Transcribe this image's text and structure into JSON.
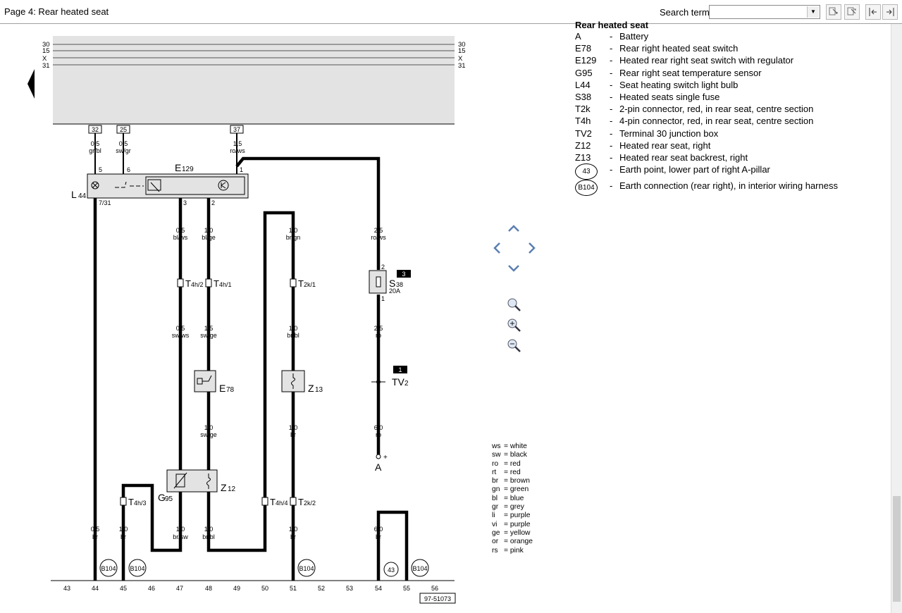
{
  "window": {
    "page_title": "Page 4: Rear heated seat"
  },
  "search": {
    "label": "Search term:",
    "value": "",
    "placeholder": ""
  },
  "toolbar": {
    "buttons": [
      "find-next-icon",
      "find-prev-icon",
      "collapse-icon",
      "expand-icon"
    ]
  },
  "legend": {
    "title": "Rear heated seat",
    "items": [
      {
        "code": "A",
        "desc": "Battery"
      },
      {
        "code": "E78",
        "desc": "Rear right heated seat switch"
      },
      {
        "code": "E129",
        "desc": "Heated rear right seat switch with regulator"
      },
      {
        "code": "G95",
        "desc": "Rear right seat temperature sensor"
      },
      {
        "code": "L44",
        "desc": "Seat heating switch light bulb"
      },
      {
        "code": "S38",
        "desc": "Heated seats single fuse"
      },
      {
        "code": "T2k",
        "desc": "2-pin connector, red, in rear seat, centre section"
      },
      {
        "code": "T4h",
        "desc": "4-pin connector, red, in rear seat, centre section"
      },
      {
        "code": "TV2",
        "desc": "Terminal 30 junction box"
      },
      {
        "code": "Z12",
        "desc": "Heated rear seat, right"
      },
      {
        "code": "Z13",
        "desc": "Heated rear seat backrest, right"
      }
    ],
    "earth_items": [
      {
        "code": "43",
        "desc": "Earth point, lower part of right A-pillar"
      },
      {
        "code": "B104",
        "desc": "Earth connection (rear right), in interior wiring harness"
      }
    ]
  },
  "colour_key": [
    {
      "code": "ws",
      "name": "white"
    },
    {
      "code": "sw",
      "name": "black"
    },
    {
      "code": "ro",
      "name": "red"
    },
    {
      "code": "rt",
      "name": "red"
    },
    {
      "code": "br",
      "name": "brown"
    },
    {
      "code": "gn",
      "name": "green"
    },
    {
      "code": "bl",
      "name": "blue"
    },
    {
      "code": "gr",
      "name": "grey"
    },
    {
      "code": "li",
      "name": "purple"
    },
    {
      "code": "vi",
      "name": "purple"
    },
    {
      "code": "ge",
      "name": "yellow"
    },
    {
      "code": "or",
      "name": "orange"
    },
    {
      "code": "rs",
      "name": "pink"
    }
  ],
  "diagram": {
    "bus_labels": [
      "30",
      "15",
      "X",
      "31"
    ],
    "fuse_box_terminals": [
      "32",
      "25",
      "37"
    ],
    "wire_labels_top": [
      {
        "size": "0,5",
        "colour": "gr/bl"
      },
      {
        "size": "0,5",
        "colour": "sw/gr"
      },
      {
        "size": "1,5",
        "colour": "ro/ws"
      }
    ],
    "e129": {
      "name": "E",
      "sub": "129",
      "pins": [
        "5",
        "6",
        "1",
        "3",
        "2"
      ],
      "pin_731": "7/31"
    },
    "l44": {
      "name": "L",
      "sub": "44"
    },
    "wire_labels_mid": [
      {
        "size": "0,5",
        "colour": "bl/ws"
      },
      {
        "size": "1,0",
        "colour": "bl/ge"
      },
      {
        "size": "1,0",
        "colour": "br/gn"
      },
      {
        "size": "2,5",
        "colour": "ro/ws"
      }
    ],
    "connectors": [
      {
        "name": "T",
        "sub": "4h/2"
      },
      {
        "name": "T",
        "sub": "4h/1"
      },
      {
        "name": "T",
        "sub": "2k/1"
      },
      {
        "name": "T",
        "sub": "4h/3"
      },
      {
        "name": "T",
        "sub": "4h/4"
      },
      {
        "name": "T",
        "sub": "2k/2"
      }
    ],
    "s38": {
      "name": "S",
      "sub": "38",
      "rating": "20A",
      "pin_top": "2",
      "pin_bottom": "1",
      "tag": "3"
    },
    "wire_labels_low": [
      {
        "size": "0,5",
        "colour": "sw/ws"
      },
      {
        "size": "1,5",
        "colour": "sw/ge"
      },
      {
        "size": "1,0",
        "colour": "br/bl"
      },
      {
        "size": "2,5",
        "colour": "ro"
      }
    ],
    "tv2": {
      "name": "TV",
      "sub": "2",
      "tag": "1"
    },
    "e78": {
      "name": "E",
      "sub": "78"
    },
    "z13": {
      "name": "Z",
      "sub": "13"
    },
    "z12": {
      "name": "Z",
      "sub": "12"
    },
    "g95": {
      "name": "G",
      "sub": "95"
    },
    "wire_labels_bottom_mid": [
      {
        "size": "1,0",
        "colour": "sw/ge"
      },
      {
        "size": "1,0",
        "colour": "br"
      },
      {
        "size": "6,0",
        "colour": "ro"
      }
    ],
    "battery": {
      "name": "A",
      "plus": "+"
    },
    "wire_labels_bottom": [
      {
        "size": "0,5",
        "colour": "br"
      },
      {
        "size": "1,0",
        "colour": "br"
      },
      {
        "size": "1,0",
        "colour": "br/sw"
      },
      {
        "size": "1,0",
        "colour": "br/bl"
      },
      {
        "size": "1,0",
        "colour": "br"
      },
      {
        "size": "6,0",
        "colour": "br"
      }
    ],
    "earth_symbols": [
      "B104",
      "B104",
      "B104",
      "43",
      "B104"
    ],
    "track_numbers": [
      "43",
      "44",
      "45",
      "46",
      "47",
      "48",
      "49",
      "50",
      "51",
      "52",
      "53",
      "54",
      "55",
      "56"
    ],
    "drawing_id": "97-51073"
  }
}
